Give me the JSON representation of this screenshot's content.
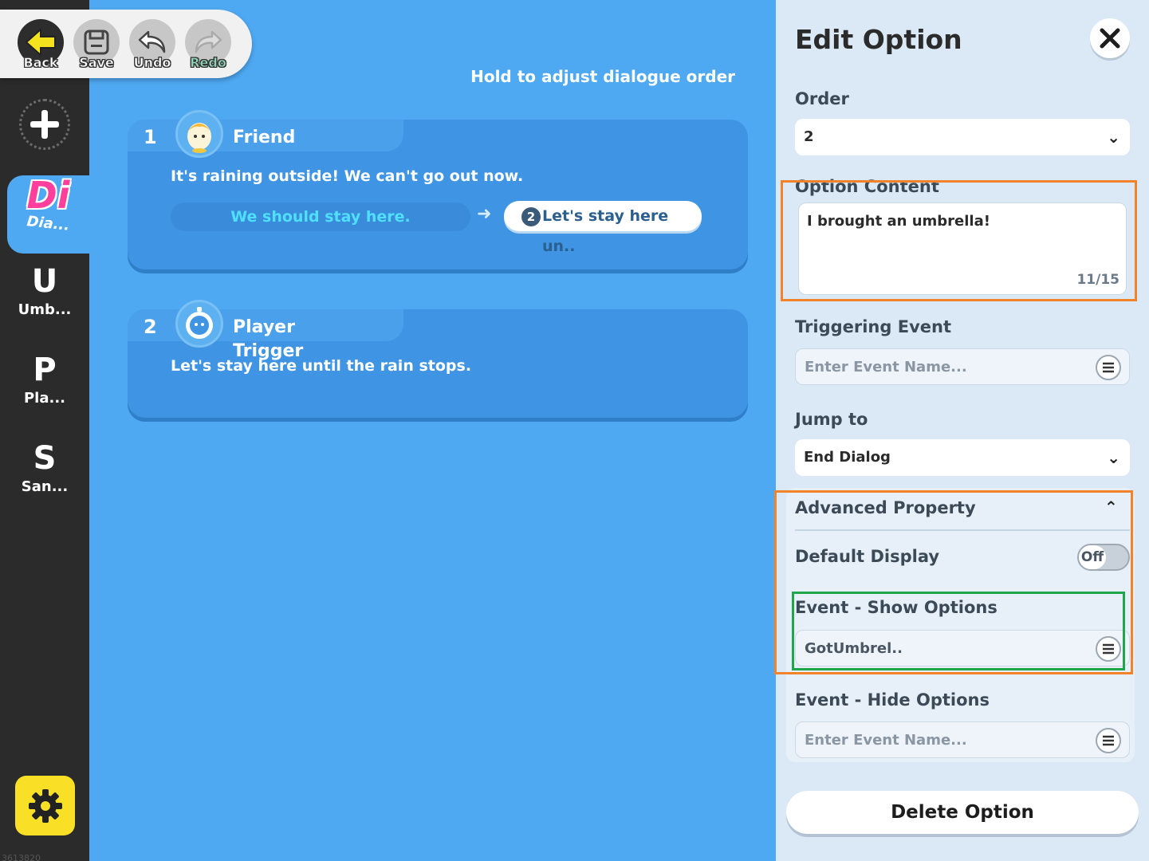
{
  "toolbar": {
    "back_label": "Back",
    "save_label": "Save",
    "undo_label": "Undo",
    "redo_label": "Redo"
  },
  "sidebar": {
    "items": [
      {
        "letter": "Di",
        "label": "Dia..."
      },
      {
        "letter": "U",
        "label": "Umb..."
      },
      {
        "letter": "P",
        "label": "Pla..."
      },
      {
        "letter": "S",
        "label": "San..."
      }
    ],
    "build_id": "3613820"
  },
  "main": {
    "hint": "Hold to adjust dialogue order",
    "cards": [
      {
        "number": "1",
        "speaker": "Friend",
        "line": "It's raining outside! We can't go out now.",
        "option_text": "We should stay here.",
        "jump_number": "2",
        "jump_text": "Let's stay here un.."
      },
      {
        "number": "2",
        "speaker": "Player\nTrigger",
        "line": "Let's stay here until the rain stops."
      }
    ]
  },
  "panel": {
    "title": "Edit Option",
    "order_label": "Order",
    "order_value": "2",
    "content_label": "Option Content",
    "content_value": "I brought an umbrella!",
    "content_count": "11/15",
    "trigger_label": "Triggering Event",
    "trigger_placeholder": "Enter Event Name...",
    "jump_label": "Jump to",
    "jump_value": "End Dialog",
    "advanced_label": "Advanced Property",
    "default_display_label": "Default Display",
    "default_display_value": "Off",
    "show_label": "Event - Show Options",
    "show_value": "GotUmbrel..",
    "hide_label": "Event - Hide Options",
    "hide_placeholder": "Enter Event Name...",
    "delete_label": "Delete Option"
  },
  "colors": {
    "background": "#4ea9f2",
    "sidebar": "#2b2b2b",
    "panel": "#dbe9f6",
    "accent_yellow": "#f9df26",
    "highlight_orange": "#f2832b",
    "highlight_green": "#1fa64a"
  }
}
